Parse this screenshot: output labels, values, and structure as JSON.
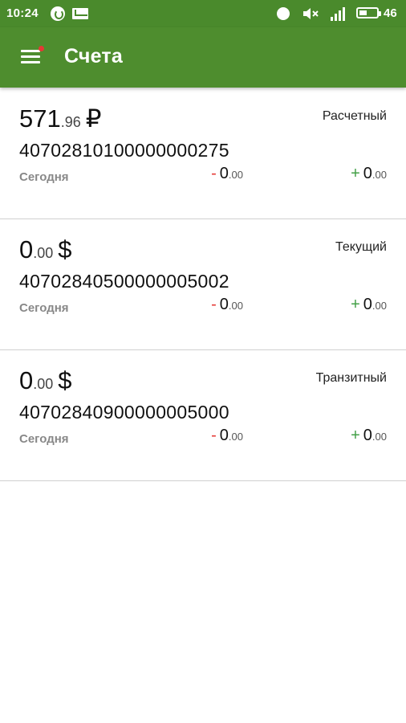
{
  "statusbar": {
    "time": "10:24",
    "battery_level": "46",
    "battery_fraction": 0.46,
    "icons": [
      "whatsapp-icon",
      "mail-icon",
      "alarm-icon",
      "mute-icon",
      "signal-icon",
      "battery-icon"
    ]
  },
  "appbar": {
    "title": "Счета",
    "menu_icon": "hamburger-menu-icon",
    "notification_dot_color": "#e53935",
    "color": "#4e8d2e"
  },
  "accounts": [
    {
      "balance_int": "571",
      "balance_frac": ".96",
      "currency": "₽",
      "type": "Расчетный",
      "number": "40702810100000000275",
      "date": "Сегодня",
      "debit_sign": "-",
      "debit_int": "0",
      "debit_frac": ".00",
      "credit_sign": "+",
      "credit_int": "0",
      "credit_frac": ".00"
    },
    {
      "balance_int": "0",
      "balance_frac": ".00",
      "currency": "$",
      "type": "Текущий",
      "number": "40702840500000005002",
      "date": "Сегодня",
      "debit_sign": "-",
      "debit_int": "0",
      "debit_frac": ".00",
      "credit_sign": "+",
      "credit_int": "0",
      "credit_frac": ".00"
    },
    {
      "balance_int": "0",
      "balance_frac": ".00",
      "currency": "$",
      "type": "Транзитный",
      "number": "40702840900000005000",
      "date": "Сегодня",
      "debit_sign": "-",
      "debit_int": "0",
      "debit_frac": ".00",
      "credit_sign": "+",
      "credit_int": "0",
      "credit_frac": ".00"
    }
  ]
}
